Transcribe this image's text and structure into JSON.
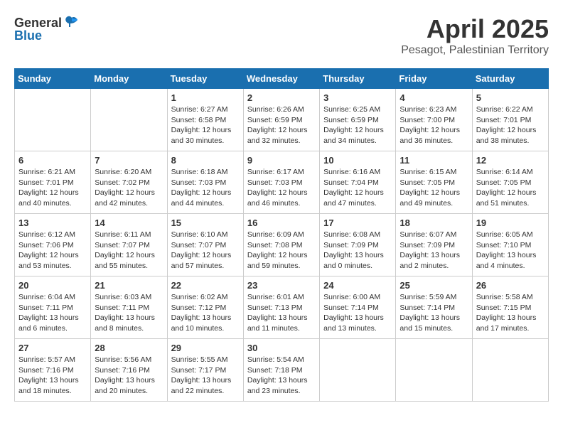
{
  "header": {
    "logo_general": "General",
    "logo_blue": "Blue",
    "month": "April 2025",
    "location": "Pesagot, Palestinian Territory"
  },
  "days_of_week": [
    "Sunday",
    "Monday",
    "Tuesday",
    "Wednesday",
    "Thursday",
    "Friday",
    "Saturday"
  ],
  "weeks": [
    [
      {
        "day": "",
        "detail": ""
      },
      {
        "day": "",
        "detail": ""
      },
      {
        "day": "1",
        "detail": "Sunrise: 6:27 AM\nSunset: 6:58 PM\nDaylight: 12 hours and 30 minutes."
      },
      {
        "day": "2",
        "detail": "Sunrise: 6:26 AM\nSunset: 6:59 PM\nDaylight: 12 hours and 32 minutes."
      },
      {
        "day": "3",
        "detail": "Sunrise: 6:25 AM\nSunset: 6:59 PM\nDaylight: 12 hours and 34 minutes."
      },
      {
        "day": "4",
        "detail": "Sunrise: 6:23 AM\nSunset: 7:00 PM\nDaylight: 12 hours and 36 minutes."
      },
      {
        "day": "5",
        "detail": "Sunrise: 6:22 AM\nSunset: 7:01 PM\nDaylight: 12 hours and 38 minutes."
      }
    ],
    [
      {
        "day": "6",
        "detail": "Sunrise: 6:21 AM\nSunset: 7:01 PM\nDaylight: 12 hours and 40 minutes."
      },
      {
        "day": "7",
        "detail": "Sunrise: 6:20 AM\nSunset: 7:02 PM\nDaylight: 12 hours and 42 minutes."
      },
      {
        "day": "8",
        "detail": "Sunrise: 6:18 AM\nSunset: 7:03 PM\nDaylight: 12 hours and 44 minutes."
      },
      {
        "day": "9",
        "detail": "Sunrise: 6:17 AM\nSunset: 7:03 PM\nDaylight: 12 hours and 46 minutes."
      },
      {
        "day": "10",
        "detail": "Sunrise: 6:16 AM\nSunset: 7:04 PM\nDaylight: 12 hours and 47 minutes."
      },
      {
        "day": "11",
        "detail": "Sunrise: 6:15 AM\nSunset: 7:05 PM\nDaylight: 12 hours and 49 minutes."
      },
      {
        "day": "12",
        "detail": "Sunrise: 6:14 AM\nSunset: 7:05 PM\nDaylight: 12 hours and 51 minutes."
      }
    ],
    [
      {
        "day": "13",
        "detail": "Sunrise: 6:12 AM\nSunset: 7:06 PM\nDaylight: 12 hours and 53 minutes."
      },
      {
        "day": "14",
        "detail": "Sunrise: 6:11 AM\nSunset: 7:07 PM\nDaylight: 12 hours and 55 minutes."
      },
      {
        "day": "15",
        "detail": "Sunrise: 6:10 AM\nSunset: 7:07 PM\nDaylight: 12 hours and 57 minutes."
      },
      {
        "day": "16",
        "detail": "Sunrise: 6:09 AM\nSunset: 7:08 PM\nDaylight: 12 hours and 59 minutes."
      },
      {
        "day": "17",
        "detail": "Sunrise: 6:08 AM\nSunset: 7:09 PM\nDaylight: 13 hours and 0 minutes."
      },
      {
        "day": "18",
        "detail": "Sunrise: 6:07 AM\nSunset: 7:09 PM\nDaylight: 13 hours and 2 minutes."
      },
      {
        "day": "19",
        "detail": "Sunrise: 6:05 AM\nSunset: 7:10 PM\nDaylight: 13 hours and 4 minutes."
      }
    ],
    [
      {
        "day": "20",
        "detail": "Sunrise: 6:04 AM\nSunset: 7:11 PM\nDaylight: 13 hours and 6 minutes."
      },
      {
        "day": "21",
        "detail": "Sunrise: 6:03 AM\nSunset: 7:11 PM\nDaylight: 13 hours and 8 minutes."
      },
      {
        "day": "22",
        "detail": "Sunrise: 6:02 AM\nSunset: 7:12 PM\nDaylight: 13 hours and 10 minutes."
      },
      {
        "day": "23",
        "detail": "Sunrise: 6:01 AM\nSunset: 7:13 PM\nDaylight: 13 hours and 11 minutes."
      },
      {
        "day": "24",
        "detail": "Sunrise: 6:00 AM\nSunset: 7:14 PM\nDaylight: 13 hours and 13 minutes."
      },
      {
        "day": "25",
        "detail": "Sunrise: 5:59 AM\nSunset: 7:14 PM\nDaylight: 13 hours and 15 minutes."
      },
      {
        "day": "26",
        "detail": "Sunrise: 5:58 AM\nSunset: 7:15 PM\nDaylight: 13 hours and 17 minutes."
      }
    ],
    [
      {
        "day": "27",
        "detail": "Sunrise: 5:57 AM\nSunset: 7:16 PM\nDaylight: 13 hours and 18 minutes."
      },
      {
        "day": "28",
        "detail": "Sunrise: 5:56 AM\nSunset: 7:16 PM\nDaylight: 13 hours and 20 minutes."
      },
      {
        "day": "29",
        "detail": "Sunrise: 5:55 AM\nSunset: 7:17 PM\nDaylight: 13 hours and 22 minutes."
      },
      {
        "day": "30",
        "detail": "Sunrise: 5:54 AM\nSunset: 7:18 PM\nDaylight: 13 hours and 23 minutes."
      },
      {
        "day": "",
        "detail": ""
      },
      {
        "day": "",
        "detail": ""
      },
      {
        "day": "",
        "detail": ""
      }
    ]
  ]
}
